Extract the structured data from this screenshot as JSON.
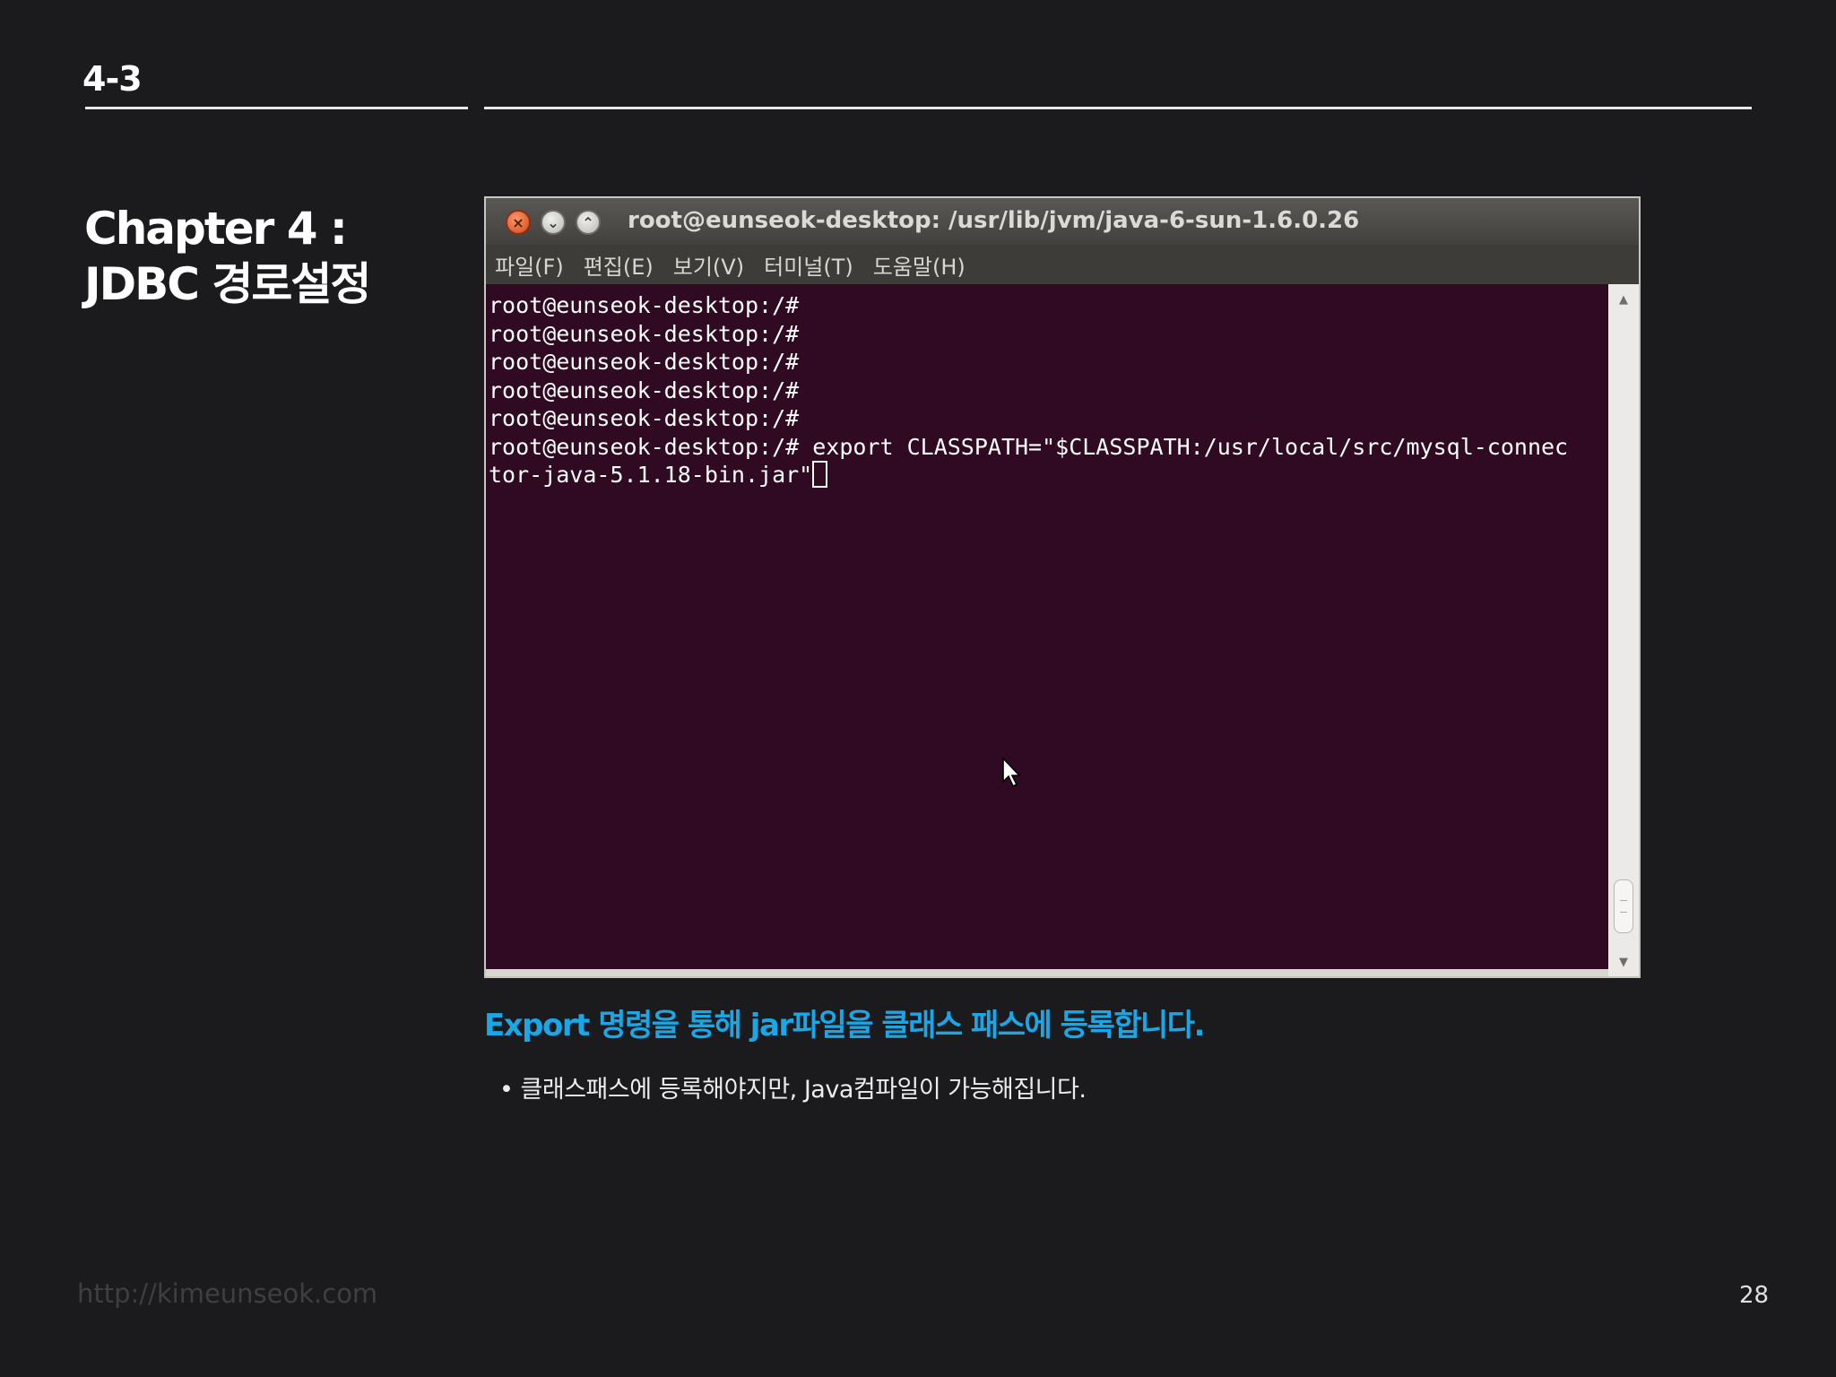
{
  "slide": {
    "section_number": "4-3",
    "chapter_title_line1": "Chapter 4 :",
    "chapter_title_line2": "JDBC 경로설정",
    "caption": "Export 명령을 통해 jar파일을 클래스 패스에 등록합니다.",
    "bullet": "• 클래스패스에 등록해야지만, Java컴파일이 가능해집니다.",
    "footer_url": "http://kimeunseok.com",
    "page_number": "28"
  },
  "terminal": {
    "window_title": "root@eunseok-desktop: /usr/lib/jvm/java-6-sun-1.6.0.26",
    "buttons": {
      "close_glyph": "×",
      "minimize_glyph": "⌄",
      "maximize_glyph": "⌃"
    },
    "menu": [
      "파일(F)",
      "편집(E)",
      "보기(V)",
      "터미널(T)",
      "도움말(H)"
    ],
    "lines": [
      "root@eunseok-desktop:/#",
      "root@eunseok-desktop:/#",
      "root@eunseok-desktop:/#",
      "root@eunseok-desktop:/#",
      "root@eunseok-desktop:/#",
      "root@eunseok-desktop:/# export CLASSPATH=\"$CLASSPATH:/usr/local/src/mysql-connec",
      "tor-java-5.1.18-bin.jar\""
    ],
    "scrollbar": {
      "up_arrow": "▲",
      "down_arrow": "▼"
    }
  },
  "colors": {
    "slide_background": "#1b1b1d",
    "terminal_background": "#2f0a22",
    "caption_accent": "#1aa7e8",
    "titlebar": "#4e4d49"
  },
  "icons": [
    "close-icon",
    "minimize-icon",
    "maximize-icon",
    "mouse-pointer-icon",
    "scroll-up-icon",
    "scroll-down-icon"
  ]
}
